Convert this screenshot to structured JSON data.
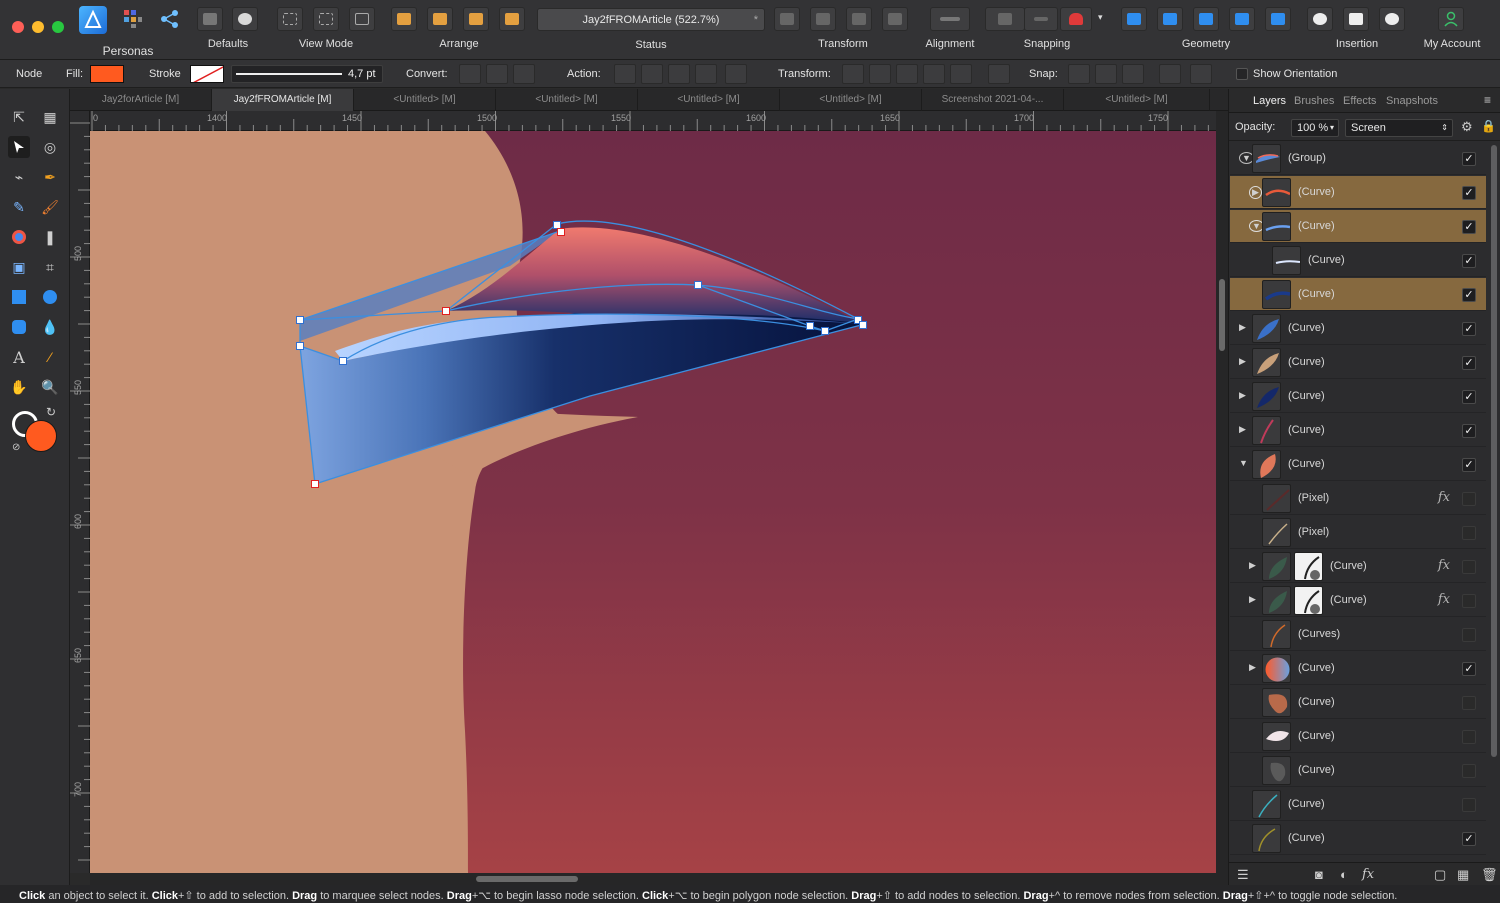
{
  "toolbar": {
    "personas_label": "Personas",
    "groups": {
      "defaults": "Defaults",
      "view_mode": "View Mode",
      "arrange": "Arrange",
      "status": "Status",
      "transform": "Transform",
      "alignment": "Alignment",
      "snapping": "Snapping",
      "geometry": "Geometry",
      "insertion": "Insertion",
      "my_account": "My Account"
    },
    "document_title": "Jay2fFROMArticle (522.7%)",
    "modified_mark": "*"
  },
  "context_bar": {
    "tool": "Node",
    "fill_label": "Fill:",
    "fill_color": "#ff5a1f",
    "stroke_label": "Stroke",
    "stroke_width": "4,7 pt",
    "convert_label": "Convert:",
    "action_label": "Action:",
    "transform_label": "Transform:",
    "snap_label": "Snap:",
    "show_orientation": "Show Orientation"
  },
  "tabs": [
    {
      "label": "Jay2forArticle [M]",
      "active": false
    },
    {
      "label": "Jay2fFROMArticle [M]",
      "active": true
    },
    {
      "label": "<Untitled> [M]",
      "active": false
    },
    {
      "label": "<Untitled> [M]",
      "active": false
    },
    {
      "label": "<Untitled> [M]",
      "active": false
    },
    {
      "label": "<Untitled> [M]",
      "active": false
    },
    {
      "label": "Screenshot 2021-04-...",
      "active": false
    },
    {
      "label": "<Untitled> [M]",
      "active": false
    }
  ],
  "rulers": {
    "unit": "px",
    "top": [
      "0",
      "1400",
      "1450",
      "1500",
      "1550",
      "1600",
      "1650",
      "1700",
      "1750"
    ],
    "left": [
      "500",
      "550",
      "600",
      "650",
      "700"
    ]
  },
  "panel": {
    "tabs": [
      "Layers",
      "Brushes",
      "Effects",
      "Snapshots"
    ],
    "active_tab": "Layers",
    "opacity_label": "Opacity:",
    "opacity_value": "100 %",
    "blend_mode": "Screen",
    "layers": [
      {
        "name": "(Group)",
        "indent": 0,
        "expander": "open",
        "selected": false,
        "visible": true,
        "fx": false,
        "mask": false,
        "thumb": "group"
      },
      {
        "name": "(Curve)",
        "indent": 1,
        "expander": "closed",
        "selected": true,
        "visible": true,
        "fx": false,
        "mask": false,
        "thumb": "orange-stroke"
      },
      {
        "name": "(Curve)",
        "indent": 1,
        "expander": "open",
        "selected": true,
        "visible": true,
        "fx": false,
        "mask": false,
        "thumb": "blue-stroke"
      },
      {
        "name": "(Curve)",
        "indent": 2,
        "expander": "none",
        "selected": false,
        "visible": true,
        "fx": false,
        "mask": false,
        "thumb": "white-stroke"
      },
      {
        "name": "(Curve)",
        "indent": 1,
        "expander": "none",
        "selected": true,
        "visible": true,
        "fx": false,
        "mask": false,
        "thumb": "navy-stroke"
      },
      {
        "name": "(Curve)",
        "indent": 0,
        "expander": "closed",
        "selected": false,
        "visible": true,
        "fx": false,
        "mask": false,
        "thumb": "blue-wing"
      },
      {
        "name": "(Curve)",
        "indent": 0,
        "expander": "closed",
        "selected": false,
        "visible": true,
        "fx": false,
        "mask": false,
        "thumb": "tan-wing"
      },
      {
        "name": "(Curve)",
        "indent": 0,
        "expander": "closed",
        "selected": false,
        "visible": true,
        "fx": false,
        "mask": false,
        "thumb": "navy-wing"
      },
      {
        "name": "(Curve)",
        "indent": 0,
        "expander": "closed",
        "selected": false,
        "visible": true,
        "fx": false,
        "mask": false,
        "thumb": "red-line"
      },
      {
        "name": "(Curve)",
        "indent": 0,
        "expander": "open",
        "selected": false,
        "visible": true,
        "fx": false,
        "mask": false,
        "thumb": "salmon-leaf"
      },
      {
        "name": "(Pixel)",
        "indent": 1,
        "expander": "none",
        "selected": false,
        "visible": false,
        "fx": true,
        "mask": false,
        "thumb": "dark-red"
      },
      {
        "name": "(Pixel)",
        "indent": 1,
        "expander": "none",
        "selected": false,
        "visible": false,
        "fx": false,
        "mask": false,
        "thumb": "sketch"
      },
      {
        "name": "(Curve)",
        "indent": 1,
        "expander": "closed",
        "selected": false,
        "visible": false,
        "fx": true,
        "mask": true,
        "thumb": "green-leaf"
      },
      {
        "name": "(Curve)",
        "indent": 1,
        "expander": "closed",
        "selected": false,
        "visible": false,
        "fx": true,
        "mask": true,
        "thumb": "green-leaf"
      },
      {
        "name": "(Curves)",
        "indent": 1,
        "expander": "none",
        "selected": false,
        "visible": false,
        "fx": false,
        "mask": false,
        "thumb": "orange-line"
      },
      {
        "name": "(Curve)",
        "indent": 1,
        "expander": "closed",
        "selected": false,
        "visible": true,
        "fx": false,
        "mask": false,
        "thumb": "gradient-ball"
      },
      {
        "name": "(Curve)",
        "indent": 1,
        "expander": "none",
        "selected": false,
        "visible": false,
        "fx": false,
        "mask": false,
        "thumb": "brown-blob"
      },
      {
        "name": "(Curve)",
        "indent": 1,
        "expander": "none",
        "selected": false,
        "visible": false,
        "fx": false,
        "mask": false,
        "thumb": "white-blob"
      },
      {
        "name": "(Curve)",
        "indent": 1,
        "expander": "none",
        "selected": false,
        "visible": false,
        "fx": false,
        "mask": false,
        "thumb": "grey-blob"
      },
      {
        "name": "(Curve)",
        "indent": 0,
        "expander": "none",
        "selected": false,
        "visible": false,
        "fx": false,
        "mask": false,
        "thumb": "teal-line"
      },
      {
        "name": "(Curve)",
        "indent": 0,
        "expander": "none",
        "selected": false,
        "visible": true,
        "fx": false,
        "mask": false,
        "thumb": "olive-line"
      }
    ]
  },
  "status_bar": [
    {
      "b": "Click",
      "t": " an object to select it. "
    },
    {
      "b": "Click",
      "t": "+⇧ to add to selection. "
    },
    {
      "b": "Drag",
      "t": " to marquee select nodes. "
    },
    {
      "b": "Drag",
      "t": "+⌥ to begin lasso node selection. "
    },
    {
      "b": "Click",
      "t": "+⌥ to begin polygon node selection. "
    },
    {
      "b": "Drag",
      "t": "+⇧ to add nodes to selection. "
    },
    {
      "b": "Drag",
      "t": "+^ to remove nodes from selection. "
    },
    {
      "b": "Drag",
      "t": "+⇧+^ to toggle node selection."
    }
  ],
  "colors": {
    "selection_highlight": "#86693f",
    "accent_blue": "#3b8fe0",
    "canvas_tan": "#c99275",
    "canvas_purple": "#6e2b47",
    "canvas_red": "#a64246"
  }
}
